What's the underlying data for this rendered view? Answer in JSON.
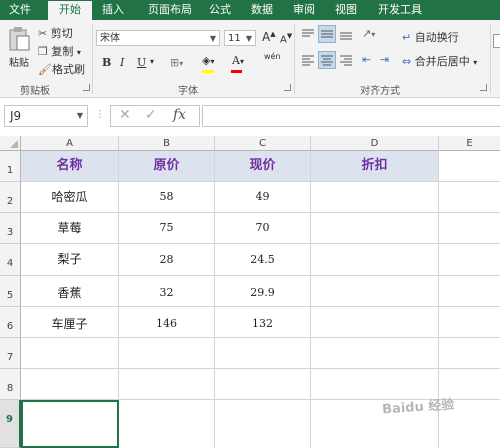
{
  "tabs": [
    "文件",
    "开始",
    "插入",
    "页面布局",
    "公式",
    "数据",
    "审阅",
    "视图",
    "开发工具"
  ],
  "active_tab": "开始",
  "clipboard": {
    "paste_label": "粘贴",
    "cut_label": "剪切",
    "copy_label": "复制",
    "format_painter_label": "格式刷",
    "group_label": "剪贴板",
    "paste_icon": "paste-icon",
    "cut_icon": "scissors-icon"
  },
  "font": {
    "name": "宋体",
    "size": "11",
    "bold_label": "B",
    "italic_label": "I",
    "underline_label": "U",
    "group_label": "字体",
    "grow_label": "A",
    "shrink_label": "A",
    "phonetic_label": "wén",
    "font_color": "#ff0000",
    "fill_color": "#ffff00"
  },
  "alignment": {
    "wrap_label": "自动换行",
    "merge_label": "合并后居中",
    "group_label": "对齐方式"
  },
  "formula_bar": {
    "name_box": "J9",
    "cancel_symbol": "✕",
    "enter_symbol": "✓",
    "fx_symbol": "fx",
    "value": ""
  },
  "columns": [
    "A",
    "B",
    "C",
    "D",
    "E"
  ],
  "rows": [
    "1",
    "2",
    "3",
    "4",
    "5",
    "6",
    "7",
    "8",
    "9"
  ],
  "selected_row": "9",
  "table": {
    "headers": [
      "名称",
      "原价",
      "现价",
      "折扣"
    ],
    "rows": [
      [
        "哈密瓜",
        "58",
        "49",
        ""
      ],
      [
        "草莓",
        "75",
        "70",
        ""
      ],
      [
        "梨子",
        "28",
        "24.5",
        ""
      ],
      [
        "香蕉",
        "32",
        "29.9",
        ""
      ],
      [
        "车厘子",
        "146",
        "132",
        ""
      ]
    ]
  },
  "watermark": "Baidu 经验",
  "colors": {
    "accent": "#217346",
    "header_fill": "#dce3ef",
    "header_text": "#7030a0"
  }
}
